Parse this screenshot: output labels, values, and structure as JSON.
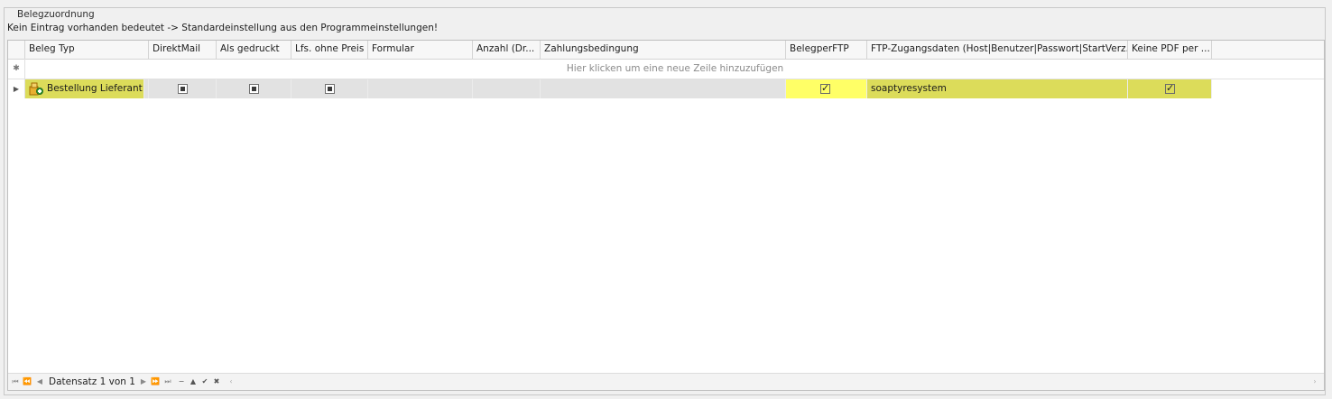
{
  "group": {
    "title": "Belegzuordnung"
  },
  "hint": "Kein Eintrag vorhanden bedeutet -> Standardeinstellung aus den Programmeinstellungen!",
  "columns": [
    "Beleg Typ",
    "DirektMail",
    "Als gedruckt",
    "Lfs. ohne Preis",
    "Formular",
    "Anzahl (Dr...",
    "Zahlungsbedingung",
    "BelegperFTP",
    "FTP-Zugangsdaten (Host|Benutzer|Passwort|StartVerz.)",
    "Keine PDF per ..."
  ],
  "new_row_text": "Hier klicken um eine neue Zeile hinzuzufügen",
  "new_row_icon": "asterisk-icon",
  "rows": [
    {
      "beleg_typ": "Bestellung Lieferant",
      "direktmail": "indeterminate",
      "als_gedruckt": "indeterminate",
      "lfs_ohne_preis": "indeterminate",
      "formular": "",
      "anzahl": "",
      "zahlungsbedingung": "",
      "beleg_per_ftp": true,
      "ftp_zugangsdaten": "soaptyresystem",
      "keine_pdf": true
    }
  ],
  "navigator": {
    "record_text": "Datensatz 1 von 1",
    "buttons": [
      "first-icon",
      "prev-page-icon",
      "prev-icon",
      "next-icon",
      "next-page-icon",
      "last-icon",
      "delete-icon",
      "up-icon",
      "accept-icon",
      "cancel-icon"
    ]
  },
  "colors": {
    "highlight_yellow": "#ffff66",
    "highlight_olive": "#dcdc5a",
    "row_gray": "#e2e2e2"
  }
}
